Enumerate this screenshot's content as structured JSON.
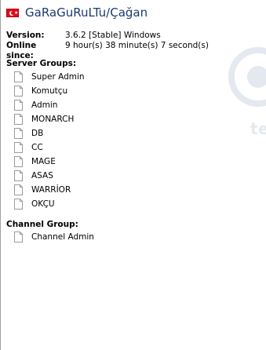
{
  "header": {
    "title": "GaRaGuRuLTu/Çağan"
  },
  "info": {
    "version_label": "Version:",
    "version_value": "3.6.2 [Stable] Windows",
    "online_label": "Online since:",
    "online_value": "9 hour(s) 38 minute(s) 7 second(s)"
  },
  "server_groups": {
    "label": "Server Groups:",
    "items": [
      "Super Admin",
      "Komutçu",
      "Admin",
      "MONARCH",
      "DB",
      "CC",
      "MAGE",
      "ASAS",
      "WARRİOR",
      "OKÇU"
    ]
  },
  "channel_group": {
    "label": "Channel Group:",
    "items": [
      "Channel Admin"
    ]
  },
  "watermark": {
    "text": "team"
  },
  "colors": {
    "title": "#1c3a70",
    "flag_red": "#e30a17"
  }
}
